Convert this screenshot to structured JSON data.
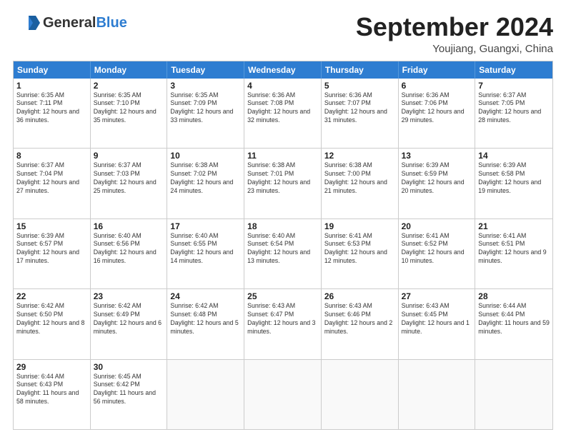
{
  "logo": {
    "general": "General",
    "blue": "Blue",
    "tagline": ""
  },
  "header": {
    "month": "September 2024",
    "location": "Youjiang, Guangxi, China"
  },
  "weekdays": [
    "Sunday",
    "Monday",
    "Tuesday",
    "Wednesday",
    "Thursday",
    "Friday",
    "Saturday"
  ],
  "rows": [
    [
      {
        "day": "",
        "sunrise": "",
        "sunset": "",
        "daylight": ""
      },
      {
        "day": "2",
        "sunrise": "Sunrise: 6:35 AM",
        "sunset": "Sunset: 7:10 PM",
        "daylight": "Daylight: 12 hours and 35 minutes."
      },
      {
        "day": "3",
        "sunrise": "Sunrise: 6:35 AM",
        "sunset": "Sunset: 7:09 PM",
        "daylight": "Daylight: 12 hours and 33 minutes."
      },
      {
        "day": "4",
        "sunrise": "Sunrise: 6:36 AM",
        "sunset": "Sunset: 7:08 PM",
        "daylight": "Daylight: 12 hours and 32 minutes."
      },
      {
        "day": "5",
        "sunrise": "Sunrise: 6:36 AM",
        "sunset": "Sunset: 7:07 PM",
        "daylight": "Daylight: 12 hours and 31 minutes."
      },
      {
        "day": "6",
        "sunrise": "Sunrise: 6:36 AM",
        "sunset": "Sunset: 7:06 PM",
        "daylight": "Daylight: 12 hours and 29 minutes."
      },
      {
        "day": "7",
        "sunrise": "Sunrise: 6:37 AM",
        "sunset": "Sunset: 7:05 PM",
        "daylight": "Daylight: 12 hours and 28 minutes."
      }
    ],
    [
      {
        "day": "8",
        "sunrise": "Sunrise: 6:37 AM",
        "sunset": "Sunset: 7:04 PM",
        "daylight": "Daylight: 12 hours and 27 minutes."
      },
      {
        "day": "9",
        "sunrise": "Sunrise: 6:37 AM",
        "sunset": "Sunset: 7:03 PM",
        "daylight": "Daylight: 12 hours and 25 minutes."
      },
      {
        "day": "10",
        "sunrise": "Sunrise: 6:38 AM",
        "sunset": "Sunset: 7:02 PM",
        "daylight": "Daylight: 12 hours and 24 minutes."
      },
      {
        "day": "11",
        "sunrise": "Sunrise: 6:38 AM",
        "sunset": "Sunset: 7:01 PM",
        "daylight": "Daylight: 12 hours and 23 minutes."
      },
      {
        "day": "12",
        "sunrise": "Sunrise: 6:38 AM",
        "sunset": "Sunset: 7:00 PM",
        "daylight": "Daylight: 12 hours and 21 minutes."
      },
      {
        "day": "13",
        "sunrise": "Sunrise: 6:39 AM",
        "sunset": "Sunset: 6:59 PM",
        "daylight": "Daylight: 12 hours and 20 minutes."
      },
      {
        "day": "14",
        "sunrise": "Sunrise: 6:39 AM",
        "sunset": "Sunset: 6:58 PM",
        "daylight": "Daylight: 12 hours and 19 minutes."
      }
    ],
    [
      {
        "day": "15",
        "sunrise": "Sunrise: 6:39 AM",
        "sunset": "Sunset: 6:57 PM",
        "daylight": "Daylight: 12 hours and 17 minutes."
      },
      {
        "day": "16",
        "sunrise": "Sunrise: 6:40 AM",
        "sunset": "Sunset: 6:56 PM",
        "daylight": "Daylight: 12 hours and 16 minutes."
      },
      {
        "day": "17",
        "sunrise": "Sunrise: 6:40 AM",
        "sunset": "Sunset: 6:55 PM",
        "daylight": "Daylight: 12 hours and 14 minutes."
      },
      {
        "day": "18",
        "sunrise": "Sunrise: 6:40 AM",
        "sunset": "Sunset: 6:54 PM",
        "daylight": "Daylight: 12 hours and 13 minutes."
      },
      {
        "day": "19",
        "sunrise": "Sunrise: 6:41 AM",
        "sunset": "Sunset: 6:53 PM",
        "daylight": "Daylight: 12 hours and 12 minutes."
      },
      {
        "day": "20",
        "sunrise": "Sunrise: 6:41 AM",
        "sunset": "Sunset: 6:52 PM",
        "daylight": "Daylight: 12 hours and 10 minutes."
      },
      {
        "day": "21",
        "sunrise": "Sunrise: 6:41 AM",
        "sunset": "Sunset: 6:51 PM",
        "daylight": "Daylight: 12 hours and 9 minutes."
      }
    ],
    [
      {
        "day": "22",
        "sunrise": "Sunrise: 6:42 AM",
        "sunset": "Sunset: 6:50 PM",
        "daylight": "Daylight: 12 hours and 8 minutes."
      },
      {
        "day": "23",
        "sunrise": "Sunrise: 6:42 AM",
        "sunset": "Sunset: 6:49 PM",
        "daylight": "Daylight: 12 hours and 6 minutes."
      },
      {
        "day": "24",
        "sunrise": "Sunrise: 6:42 AM",
        "sunset": "Sunset: 6:48 PM",
        "daylight": "Daylight: 12 hours and 5 minutes."
      },
      {
        "day": "25",
        "sunrise": "Sunrise: 6:43 AM",
        "sunset": "Sunset: 6:47 PM",
        "daylight": "Daylight: 12 hours and 3 minutes."
      },
      {
        "day": "26",
        "sunrise": "Sunrise: 6:43 AM",
        "sunset": "Sunset: 6:46 PM",
        "daylight": "Daylight: 12 hours and 2 minutes."
      },
      {
        "day": "27",
        "sunrise": "Sunrise: 6:43 AM",
        "sunset": "Sunset: 6:45 PM",
        "daylight": "Daylight: 12 hours and 1 minute."
      },
      {
        "day": "28",
        "sunrise": "Sunrise: 6:44 AM",
        "sunset": "Sunset: 6:44 PM",
        "daylight": "Daylight: 11 hours and 59 minutes."
      }
    ],
    [
      {
        "day": "29",
        "sunrise": "Sunrise: 6:44 AM",
        "sunset": "Sunset: 6:43 PM",
        "daylight": "Daylight: 11 hours and 58 minutes."
      },
      {
        "day": "30",
        "sunrise": "Sunrise: 6:45 AM",
        "sunset": "Sunset: 6:42 PM",
        "daylight": "Daylight: 11 hours and 56 minutes."
      },
      {
        "day": "",
        "sunrise": "",
        "sunset": "",
        "daylight": ""
      },
      {
        "day": "",
        "sunrise": "",
        "sunset": "",
        "daylight": ""
      },
      {
        "day": "",
        "sunrise": "",
        "sunset": "",
        "daylight": ""
      },
      {
        "day": "",
        "sunrise": "",
        "sunset": "",
        "daylight": ""
      },
      {
        "day": "",
        "sunrise": "",
        "sunset": "",
        "daylight": ""
      }
    ]
  ],
  "first_row": [
    {
      "day": "1",
      "sunrise": "Sunrise: 6:35 AM",
      "sunset": "Sunset: 7:11 PM",
      "daylight": "Daylight: 12 hours and 36 minutes."
    }
  ]
}
